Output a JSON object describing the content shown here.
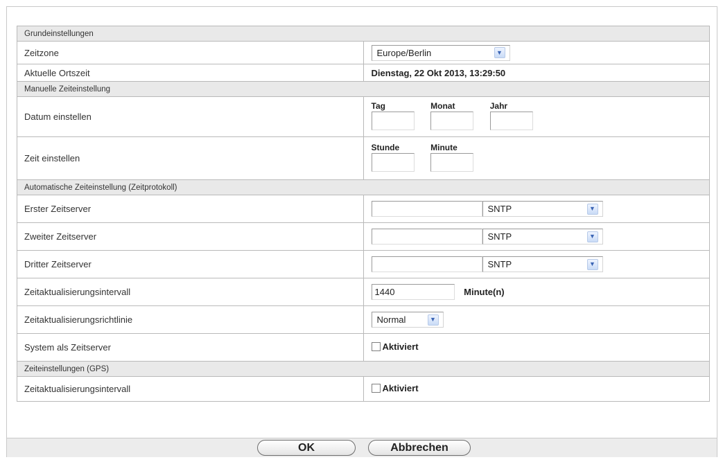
{
  "sections": {
    "grund": "Grundeinstellungen",
    "manuell": "Manuelle Zeiteinstellung",
    "auto": "Automatische Zeiteinstellung (Zeitprotokoll)",
    "gps": "Zeiteinstellungen (GPS)"
  },
  "zeitzone": {
    "label": "Zeitzone",
    "value": "Europe/Berlin"
  },
  "ortszeit": {
    "label": "Aktuelle Ortszeit",
    "value": "Dienstag, 22 Okt 2013, 13:29:50"
  },
  "datum": {
    "label": "Datum einstellen",
    "tag_label": "Tag",
    "monat_label": "Monat",
    "jahr_label": "Jahr",
    "tag_value": "",
    "monat_value": "",
    "jahr_value": ""
  },
  "zeit": {
    "label": "Zeit einstellen",
    "stunde_label": "Stunde",
    "minute_label": "Minute",
    "stunde_value": "",
    "minute_value": ""
  },
  "server1": {
    "label": "Erster Zeitserver",
    "value": "",
    "protocol": "SNTP"
  },
  "server2": {
    "label": "Zweiter Zeitserver",
    "value": "",
    "protocol": "SNTP"
  },
  "server3": {
    "label": "Dritter Zeitserver",
    "value": "",
    "protocol": "SNTP"
  },
  "intervall": {
    "label": "Zeitaktualisierungsintervall",
    "value": "1440",
    "unit": "Minute(n)"
  },
  "richtlinie": {
    "label": "Zeitaktualisierungsrichtlinie",
    "value": "Normal"
  },
  "systemserver": {
    "label": "System als Zeitserver",
    "checkbox_label": "Aktiviert",
    "checked": false
  },
  "gps_intervall": {
    "label": "Zeitaktualisierungsintervall",
    "checkbox_label": "Aktiviert",
    "checked": false
  },
  "buttons": {
    "ok": "OK",
    "cancel": "Abbrechen"
  },
  "icons": {
    "dropdown": "chevron-down-icon"
  },
  "colors": {
    "section_bg": "#e9e9e9",
    "border": "#b9b9b9",
    "footer_bg": "#ececec",
    "arrow": "#3a64b4"
  }
}
